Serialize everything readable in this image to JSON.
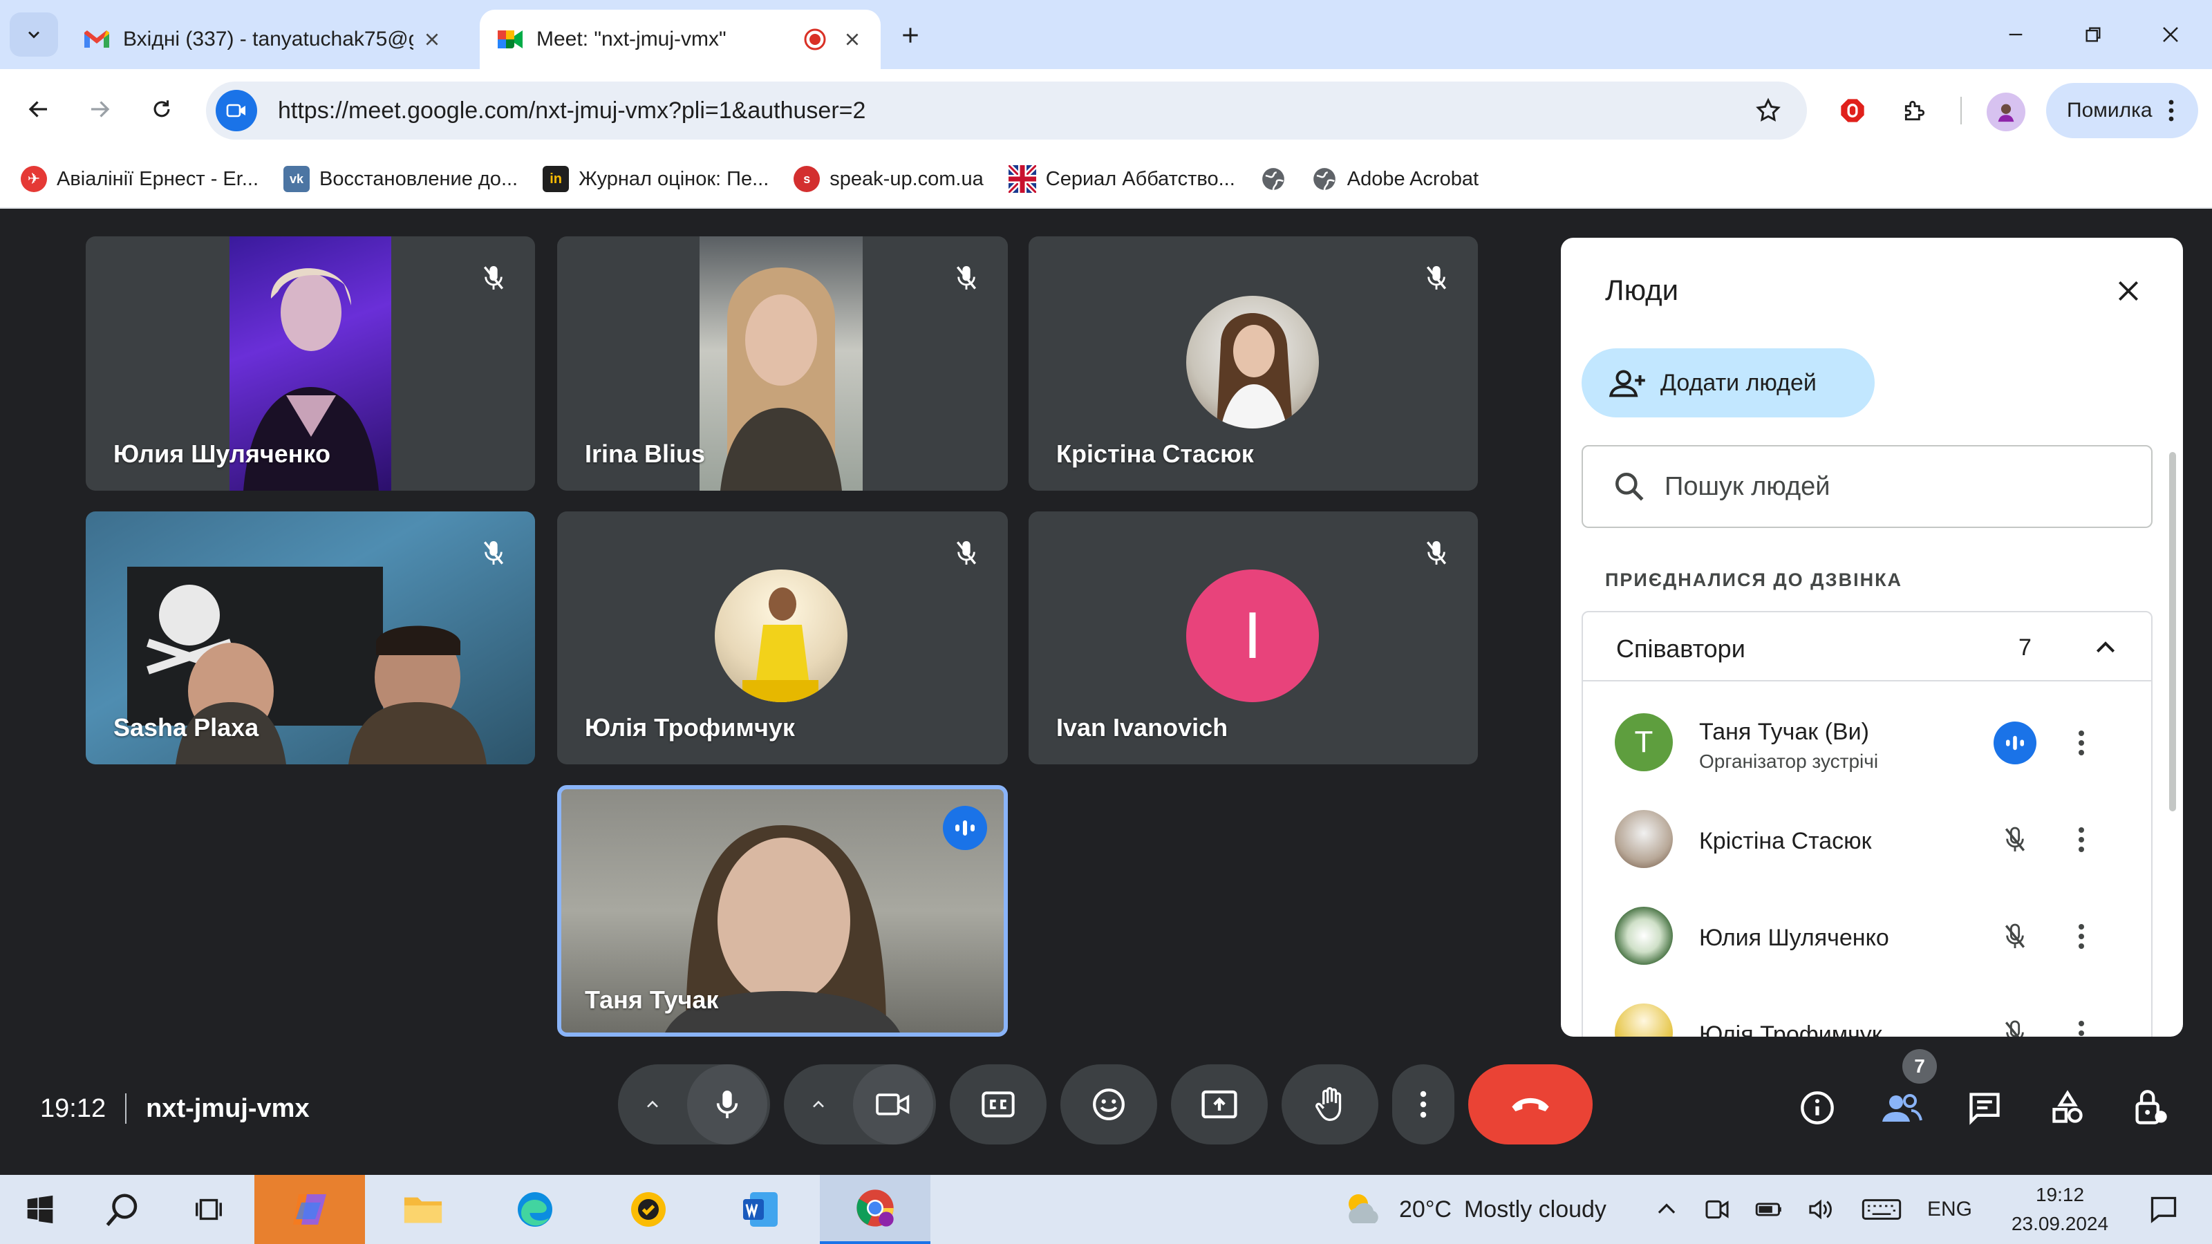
{
  "browser": {
    "tabs": [
      {
        "title": "Вхідні (337) - tanyatuchak75@g"
      },
      {
        "title": "Meet: \"nxt-jmuj-vmx\""
      }
    ],
    "url": "https://meet.google.com/nxt-jmuj-vmx?pli=1&authuser=2",
    "profile_error_label": "Помилка",
    "bookmarks": [
      {
        "label": "Авіалінії Ернест - Er...",
        "color": "#e53935",
        "glyph": "✈"
      },
      {
        "label": "Восстановление до...",
        "color": "#4c75a3",
        "glyph": "vk"
      },
      {
        "label": "Журнал оцінок: Пе...",
        "color": "#1f1f1f",
        "glyph": "in"
      },
      {
        "label": "speak-up.com.ua",
        "color": "#d32f2f",
        "glyph": "s"
      },
      {
        "label": "Сериал Аббатство...",
        "color": "#1a3a8f",
        "glyph": "✚"
      },
      {
        "label": "",
        "color": "#5f6368",
        "glyph": "◍"
      },
      {
        "label": "Adobe Acrobat",
        "color": "#5f6368",
        "glyph": "◍"
      }
    ]
  },
  "meet": {
    "participants": [
      {
        "name": "Юлия Шуляченко",
        "kind": "video-purple",
        "muted": true
      },
      {
        "name": "Irina Blius",
        "kind": "video-girl",
        "muted": true
      },
      {
        "name": "Крістіна Стасюк",
        "kind": "avatar-photo",
        "muted": true
      },
      {
        "name": "Sasha Plaxa",
        "kind": "video-room",
        "muted": true
      },
      {
        "name": "Юлія Трофимчук",
        "kind": "avatar-photo-yellow",
        "muted": true
      },
      {
        "name": "Ivan Ivanovich",
        "kind": "avatar-letter",
        "letter": "I",
        "avatar_color": "#e8437b",
        "muted": true
      },
      {
        "name": "Таня Тучак",
        "kind": "video-self",
        "muted": false,
        "speaking": true
      }
    ],
    "clock": "19:12",
    "meeting_code": "nxt-jmuj-vmx",
    "people_badge": "7",
    "end_call_color": "#ea4335",
    "accent": "#1a73e8"
  },
  "people_panel": {
    "title": "Люди",
    "add_people_label": "Додати людей",
    "search_placeholder": "Пошук людей",
    "section_label": "ПРИЄДНАЛИСЯ ДО ДЗВІНКА",
    "group_label": "Співавтори",
    "group_count": "7",
    "list": [
      {
        "name": "Таня Тучак (Ви)",
        "role": "Організатор зустрічі",
        "avatar_letter": "T",
        "avatar_color": "#5e9e3e",
        "speaking": true
      },
      {
        "name": "Крістіна Стасюк",
        "role": "",
        "muted": true
      },
      {
        "name": "Юлия Шуляченко",
        "role": "",
        "muted": true
      },
      {
        "name": "Юлія Трофимчук",
        "role": "",
        "muted": true
      }
    ]
  },
  "taskbar": {
    "weather_temp": "20°C",
    "weather_desc": "Mostly cloudy",
    "lang": "ENG",
    "time": "19:12",
    "date": "23.09.2024"
  }
}
